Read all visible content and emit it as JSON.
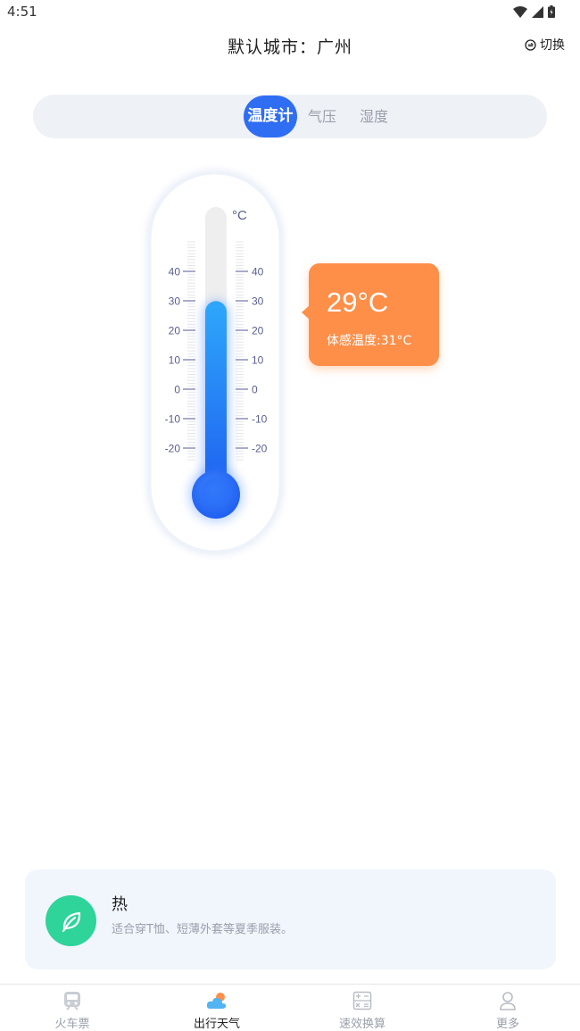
{
  "status_bar": {
    "time": "4:51"
  },
  "header": {
    "title": "默认城市：广州",
    "switch_label": "切换"
  },
  "tabs": [
    {
      "label": "温度计",
      "active": true
    },
    {
      "label": "气压",
      "active": false
    },
    {
      "label": "湿度",
      "active": false
    }
  ],
  "thermometer": {
    "unit": "°C",
    "scale_ticks": [
      "40",
      "30",
      "20",
      "10",
      "0",
      "-10",
      "-20"
    ],
    "current_temp": "29°C",
    "feels_like": "体感温度:31°C",
    "current_value": 29,
    "range": [
      -20,
      40
    ]
  },
  "feel_card": {
    "title": "热",
    "description": "适合穿T恤、短薄外套等夏季服装。"
  },
  "bottom_nav": [
    {
      "label": "火车票",
      "icon": "train-icon",
      "active": false
    },
    {
      "label": "出行天气",
      "icon": "weather-icon",
      "active": true
    },
    {
      "label": "速效换算",
      "icon": "calculator-icon",
      "active": false
    },
    {
      "label": "更多",
      "icon": "user-icon",
      "active": false
    }
  ],
  "colors": {
    "accent": "#2f6df3",
    "tooltip": "#fd8f49",
    "leaf": "#2ed49a",
    "mercury_top": "#2ea8fb",
    "mercury_bottom": "#1f5ff0"
  }
}
